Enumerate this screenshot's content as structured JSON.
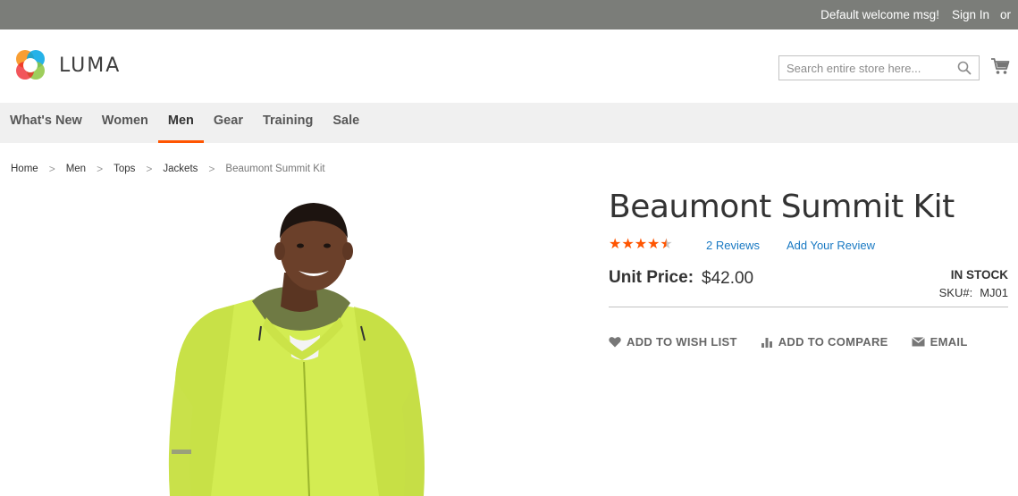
{
  "topbar": {
    "welcome": "Default welcome msg!",
    "sign_in": "Sign In",
    "or": "or"
  },
  "header": {
    "brand": "LUMA",
    "search_placeholder": "Search entire store here...",
    "search_icon": "search-icon",
    "cart_icon": "cart-icon"
  },
  "nav": {
    "items": [
      {
        "label": "What's New"
      },
      {
        "label": "Women"
      },
      {
        "label": "Men",
        "active": true
      },
      {
        "label": "Gear"
      },
      {
        "label": "Training"
      },
      {
        "label": "Sale"
      }
    ]
  },
  "breadcrumbs": {
    "items": [
      "Home",
      "Men",
      "Tops",
      "Jackets"
    ],
    "current": "Beaumont Summit Kit",
    "separator": ">"
  },
  "product": {
    "title": "Beaumont Summit Kit",
    "rating_fraction": 0.9,
    "reviews_link": "2 Reviews",
    "add_review_link": "Add Your Review",
    "unit_price_label": "Unit Price:",
    "unit_price": "$42.00",
    "stock": "IN STOCK",
    "sku_label": "SKU#:",
    "sku": "MJ01",
    "actions": {
      "wishlist": "ADD TO WISH LIST",
      "compare": "ADD TO COMPARE",
      "email": "EMAIL"
    }
  },
  "colors": {
    "accent": "#ff5501",
    "link": "#1979c3",
    "topbar": "#7b7d79",
    "nav_bg": "#f0f0f0",
    "jacket": "#d3ec52"
  }
}
